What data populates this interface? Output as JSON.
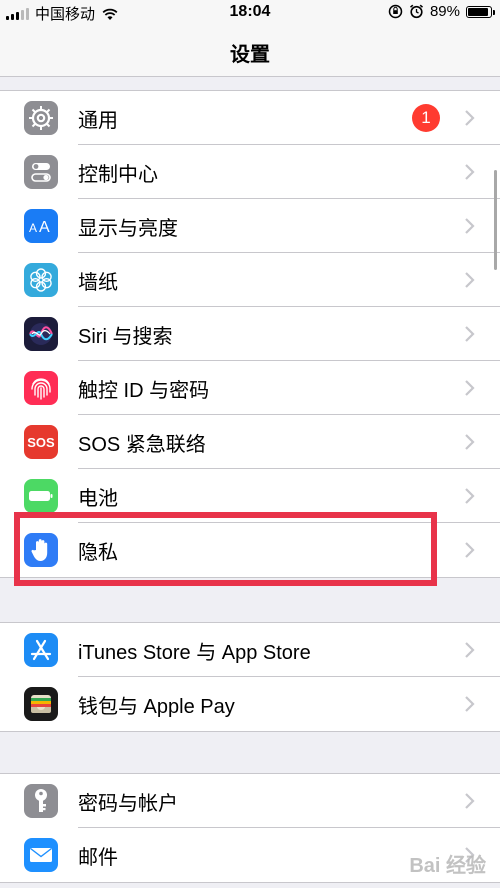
{
  "status_bar": {
    "carrier": "中国移动",
    "time": "18:04",
    "battery": "89%",
    "battery_level": 0.89
  },
  "nav": {
    "title": "设置"
  },
  "groups": [
    {
      "items": [
        {
          "label": "通用",
          "icon": "gear-icon",
          "badge": "1"
        },
        {
          "label": "控制中心",
          "icon": "control-center-icon"
        },
        {
          "label": "显示与亮度",
          "icon": "display-brightness-icon"
        },
        {
          "label": "墙纸",
          "icon": "wallpaper-icon"
        },
        {
          "label": "Siri 与搜索",
          "icon": "siri-icon"
        },
        {
          "label": "触控 ID 与密码",
          "icon": "fingerprint-icon"
        },
        {
          "label": "SOS 紧急联络",
          "icon": "sos-icon",
          "icon_text": "SOS"
        },
        {
          "label": "电池",
          "icon": "battery-icon"
        },
        {
          "label": "隐私",
          "icon": "privacy-hand-icon"
        }
      ]
    },
    {
      "items": [
        {
          "label": "iTunes Store 与 App Store",
          "icon": "app-store-icon"
        },
        {
          "label": "钱包与 Apple Pay",
          "icon": "wallet-icon"
        }
      ]
    },
    {
      "items": [
        {
          "label": "密码与帐户",
          "icon": "key-icon"
        },
        {
          "label": "邮件",
          "icon": "mail-icon"
        }
      ]
    }
  ],
  "colors": {
    "general": "#8e8e93",
    "control_center": "#8e8e93",
    "display": "#1a7cf5",
    "wallpaper": "#34aadc",
    "siri": "#1c1c3a",
    "touch_id": "#ff2d55",
    "sos": "#e6392e",
    "battery": "#4cd964",
    "privacy": "#2f7cf6",
    "app_store": "#1d8cf5",
    "wallet": "#1a1a1a",
    "passwords": "#8e8e93",
    "mail": "#1e90ff",
    "highlight": "#e8334a",
    "badge": "#ff3b30"
  },
  "watermark": "Bai 经验"
}
